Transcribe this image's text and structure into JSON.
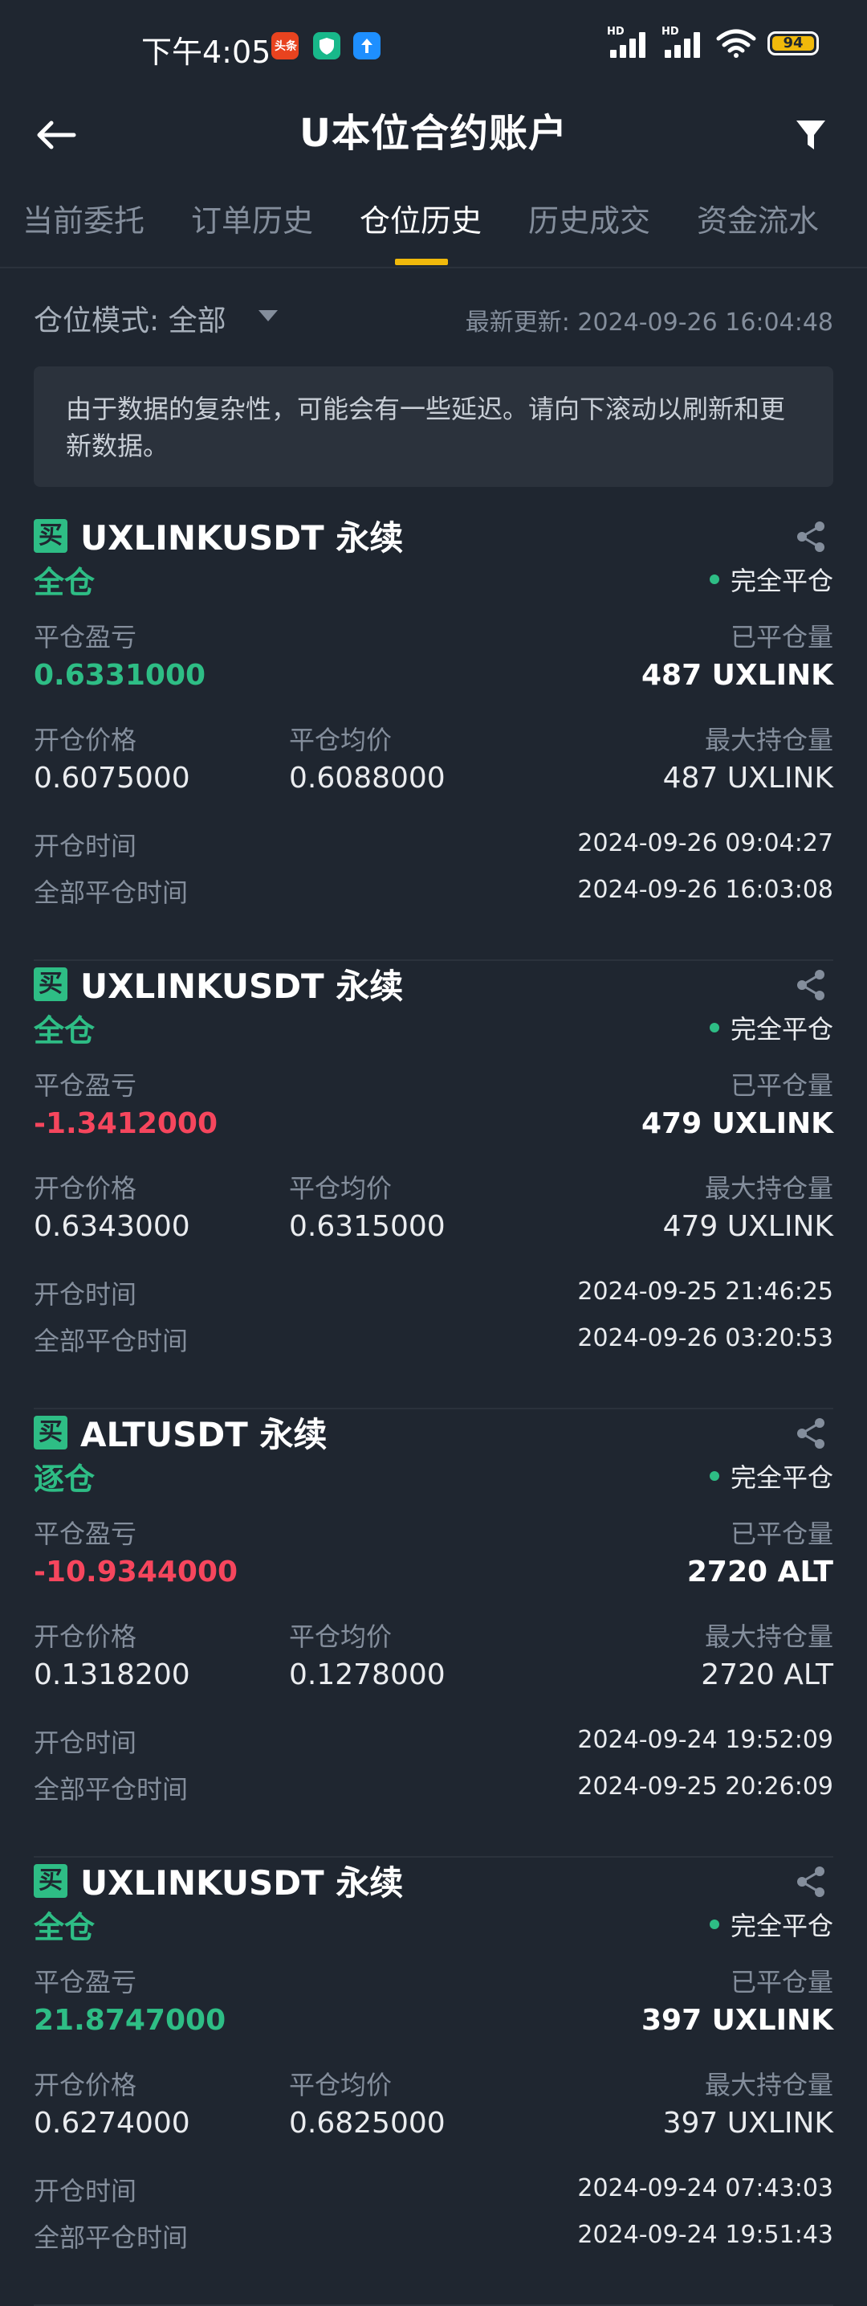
{
  "status_bar": {
    "time": "下午4:05",
    "app_icon_1": "头条",
    "battery": "94"
  },
  "header": {
    "title": "U本位合约账户"
  },
  "tabs": [
    {
      "label": "当前委托"
    },
    {
      "label": "订单历史"
    },
    {
      "label": "仓位历史"
    },
    {
      "label": "历史成交"
    },
    {
      "label": "资金流水"
    }
  ],
  "filter": {
    "mode_label": "仓位模式: 全部",
    "updated": "最新更新: 2024-09-26 16:04:48"
  },
  "notice": "由于数据的复杂性，可能会有一些延迟。请向下滚动以刷新和更新数据。",
  "labels": {
    "buy": "买",
    "pnl": "平仓盈亏",
    "closed_qty": "已平仓量",
    "open_price": "开仓价格",
    "close_avg": "平仓均价",
    "max_qty": "最大持仓量",
    "open_time": "开仓时间",
    "close_time": "全部平仓时间"
  },
  "positions": [
    {
      "symbol": "UXLINKUSDT 永续",
      "margin": "全仓",
      "status": "完全平仓",
      "pnl": "0.6331000",
      "pnl_sign": "pos",
      "closed_qty": "487 UXLINK",
      "open_price": "0.6075000",
      "close_avg": "0.6088000",
      "max_qty": "487 UXLINK",
      "open_time": "2024-09-26 09:04:27",
      "close_time": "2024-09-26 16:03:08"
    },
    {
      "symbol": "UXLINKUSDT 永续",
      "margin": "全仓",
      "status": "完全平仓",
      "pnl": "-1.3412000",
      "pnl_sign": "neg",
      "closed_qty": "479 UXLINK",
      "open_price": "0.6343000",
      "close_avg": "0.6315000",
      "max_qty": "479 UXLINK",
      "open_time": "2024-09-25 21:46:25",
      "close_time": "2024-09-26 03:20:53"
    },
    {
      "symbol": "ALTUSDT 永续",
      "margin": "逐仓",
      "status": "完全平仓",
      "pnl": "-10.9344000",
      "pnl_sign": "neg",
      "closed_qty": "2720 ALT",
      "open_price": "0.1318200",
      "close_avg": "0.1278000",
      "max_qty": "2720 ALT",
      "open_time": "2024-09-24 19:52:09",
      "close_time": "2024-09-25 20:26:09"
    },
    {
      "symbol": "UXLINKUSDT 永续",
      "margin": "全仓",
      "status": "完全平仓",
      "pnl": "21.8747000",
      "pnl_sign": "pos",
      "closed_qty": "397 UXLINK",
      "open_price": "0.6274000",
      "close_avg": "0.6825000",
      "max_qty": "397 UXLINK",
      "open_time": "2024-09-24 07:43:03",
      "close_time": "2024-09-24 19:51:43"
    }
  ],
  "colors": {
    "background": "#1f2630",
    "accent": "#f0b90b",
    "positive": "#2ebd85",
    "negative": "#f6465d"
  },
  "icons": [
    "back-arrow-icon",
    "filter-funnel-icon",
    "share-icon",
    "dropdown-caret-icon"
  ]
}
